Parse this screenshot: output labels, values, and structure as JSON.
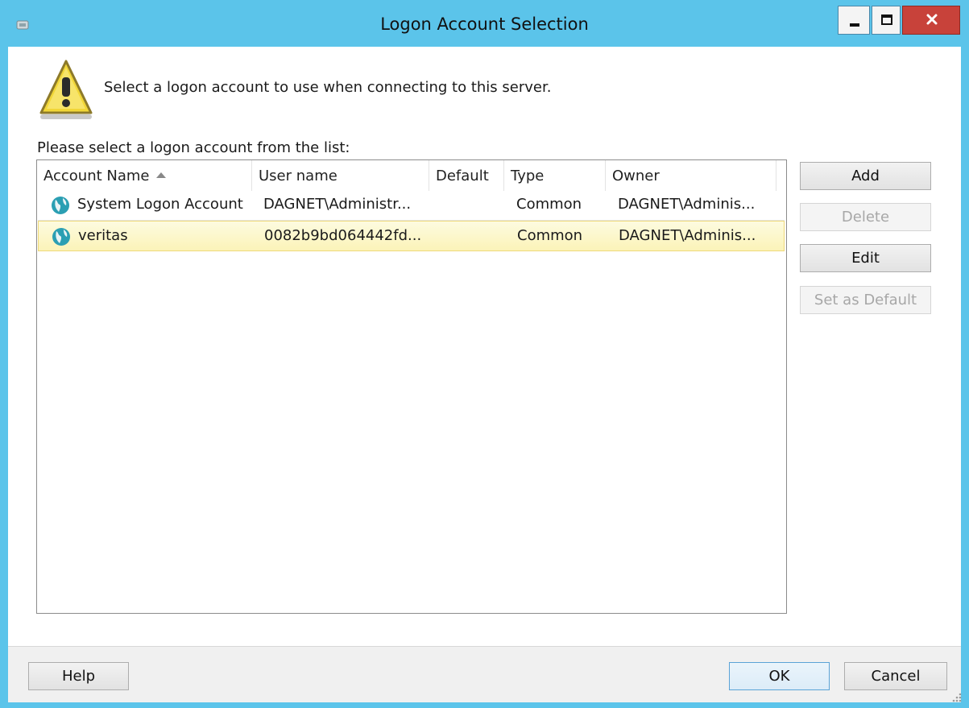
{
  "window": {
    "title": "Logon Account Selection",
    "icons": {
      "app": "app-icon",
      "minimize": "minimize-icon",
      "maximize": "maximize-icon",
      "close": "close-icon"
    }
  },
  "message": {
    "icon": "warning-icon",
    "text": "Select a logon account to use when connecting to this server."
  },
  "list": {
    "label": "Please select a logon account from the list:",
    "sort_column": "Account Name",
    "sort_direction": "ascending",
    "columns": [
      "Account Name",
      "User name",
      "Default",
      "Type",
      "Owner"
    ],
    "rows": [
      {
        "icon": "globe-icon",
        "account_name": "System Logon Account",
        "user_name": "DAGNET\\Administr...",
        "default": "",
        "type": "Common",
        "owner": "DAGNET\\Adminis...",
        "selected": false
      },
      {
        "icon": "globe-icon",
        "account_name": "veritas",
        "user_name": "0082b9bd064442fd...",
        "default": "",
        "type": "Common",
        "owner": "DAGNET\\Adminis...",
        "selected": true
      }
    ]
  },
  "side_buttons": {
    "add": "Add",
    "delete": "Delete",
    "edit": "Edit",
    "set_default": "Set as Default"
  },
  "footer": {
    "help": "Help",
    "ok": "OK",
    "cancel": "Cancel"
  },
  "colors": {
    "titlebar": "#5bc4ea",
    "close_button": "#c8423a",
    "selected_row": "#fbf3b8",
    "disabled_text": "#a7a7a7"
  }
}
